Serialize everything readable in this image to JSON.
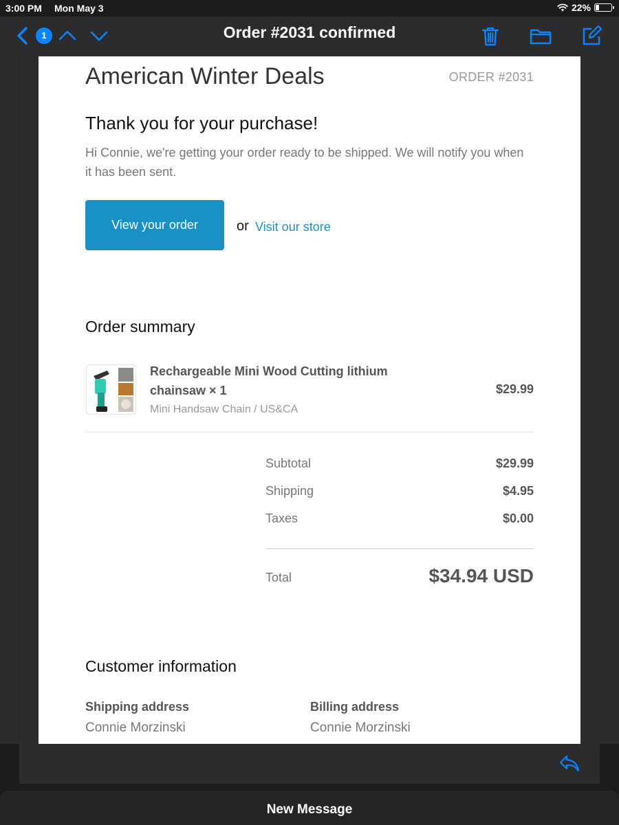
{
  "status_bar": {
    "time": "3:00 PM",
    "date": "Mon May 3",
    "battery_percent": "22%",
    "battery_level": 0.22,
    "icons": [
      "wifi-icon",
      "battery-icon"
    ]
  },
  "nav": {
    "title": "Order #2031 confirmed",
    "unread_count": "1",
    "icons": [
      "back-chevron-icon",
      "up-arrow-icon",
      "down-arrow-icon",
      "trash-icon",
      "folder-icon",
      "compose-icon"
    ],
    "accent": "#0a84ff"
  },
  "email": {
    "store_name": "American Winter Deals",
    "order_number": "ORDER #2031",
    "thanks_heading": "Thank you for your purchase!",
    "intro_text": "Hi Connie, we're getting your order ready to be shipped. We will notify you when it has been sent.",
    "view_order_label": "View your order",
    "or_text": "or",
    "visit_store_label": "Visit our store",
    "button_color": "#1990c6",
    "summary_title": "Order summary",
    "item": {
      "name": "Rechargeable Mini Wood Cutting lithium chainsaw × 1",
      "variant": "Mini Handsaw Chain / US&CA",
      "price": "$29.99"
    },
    "totals": [
      {
        "label": "Subtotal",
        "value": "$29.99"
      },
      {
        "label": "Shipping",
        "value": "$4.95"
      },
      {
        "label": "Taxes",
        "value": "$0.00"
      }
    ],
    "total_label": "Total",
    "total_value": "$34.94 USD",
    "customer_title": "Customer information",
    "shipping_address": {
      "heading": "Shipping address",
      "name": "Connie Morzinski"
    },
    "billing_address": {
      "heading": "Billing address",
      "name": "Connie Morzinski"
    }
  },
  "toolbar": {
    "icons": [
      "reply-icon"
    ]
  },
  "new_message": {
    "label": "New Message"
  }
}
